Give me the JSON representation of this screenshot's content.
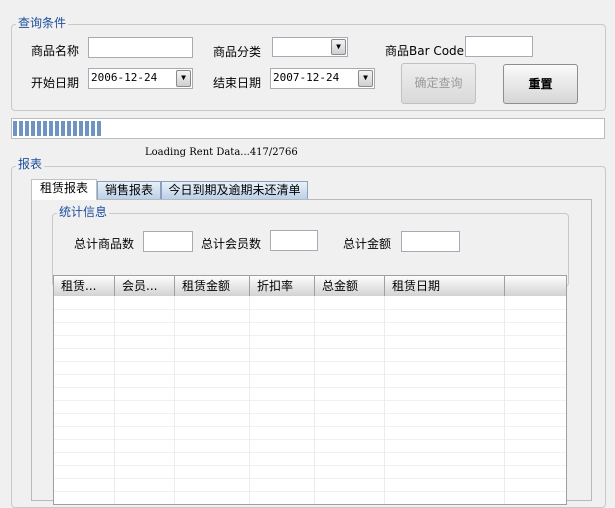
{
  "query": {
    "title": "查询条件",
    "name_label": "商品名称",
    "name_value": "",
    "category_label": "商品分类",
    "category_value": "",
    "barcode_label": "商品Bar Code",
    "barcode_value": "",
    "start_label": "开始日期",
    "start_value": "2006-12-24",
    "end_label": "结束日期",
    "end_value": "2007-12-24",
    "confirm_label": "确定查询",
    "reset_label": "重置"
  },
  "progress": {
    "value": 417,
    "total": 2766,
    "fraction": 0.15,
    "text": "Loading Rent Data...417/2766"
  },
  "report": {
    "title": "报表",
    "tabs": [
      {
        "label": "租赁报表",
        "selected": true
      },
      {
        "label": "销售报表"
      },
      {
        "label": "今日到期及逾期未还清单"
      }
    ],
    "stats": {
      "title": "统计信息",
      "goods_label": "总计商品数",
      "goods_value": "",
      "members_label": "总计会员数",
      "members_value": "",
      "amount_label": "总计金额",
      "amount_value": ""
    },
    "columns": [
      "租赁...",
      "会员...",
      "租赁金额",
      "折扣率",
      "总金额",
      "租赁日期",
      ""
    ]
  }
}
